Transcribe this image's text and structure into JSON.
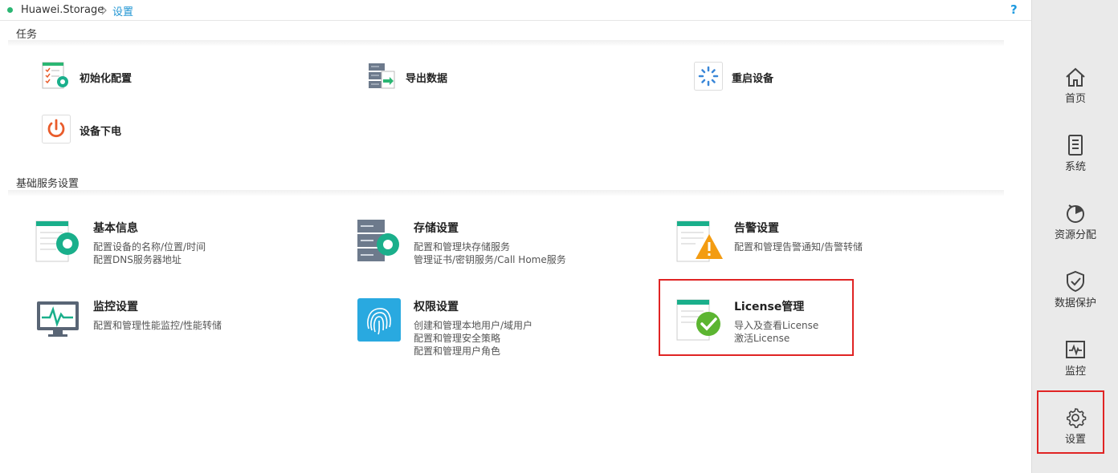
{
  "breadcrumb": {
    "root": "Huawei.Storage",
    "current": "设置"
  },
  "help": "?",
  "sections": {
    "tasks": "任务",
    "services": "基础服务设置"
  },
  "tasks": [
    {
      "label": "初始化配置",
      "icon": "init-config-icon"
    },
    {
      "label": "导出数据",
      "icon": "export-data-icon"
    },
    {
      "label": "重启设备",
      "icon": "restart-icon"
    },
    {
      "label": "设备下电",
      "icon": "power-off-icon"
    }
  ],
  "services": [
    {
      "title": "基本信息",
      "desc1": "配置设备的名称/位置/时间",
      "desc2": "配置DNS服务器地址",
      "desc3": ""
    },
    {
      "title": "存储设置",
      "desc1": "配置和管理块存储服务",
      "desc2": "管理证书/密钥服务/Call Home服务",
      "desc3": ""
    },
    {
      "title": "告警设置",
      "desc1": "配置和管理告警通知/告警转储",
      "desc2": "",
      "desc3": ""
    },
    {
      "title": "监控设置",
      "desc1": "配置和管理性能监控/性能转储",
      "desc2": "",
      "desc3": ""
    },
    {
      "title": "权限设置",
      "desc1": "创建和管理本地用户/域用户",
      "desc2": "配置和管理安全策略",
      "desc3": "配置和管理用户角色"
    },
    {
      "title": "License管理",
      "desc1": "导入及查看License",
      "desc2": "激活License",
      "desc3": ""
    }
  ],
  "nav": [
    {
      "label": "首页",
      "icon": "home-icon"
    },
    {
      "label": "系统",
      "icon": "system-icon"
    },
    {
      "label": "资源分配",
      "icon": "resource-allocation-icon"
    },
    {
      "label": "数据保护",
      "icon": "data-protection-icon"
    },
    {
      "label": "监控",
      "icon": "monitor-icon"
    },
    {
      "label": "设置",
      "icon": "settings-icon"
    }
  ],
  "colors": {
    "accent": "#2196d3",
    "highlight": "#e02424",
    "teal": "#1aaf8b",
    "status": "#2bb673"
  }
}
